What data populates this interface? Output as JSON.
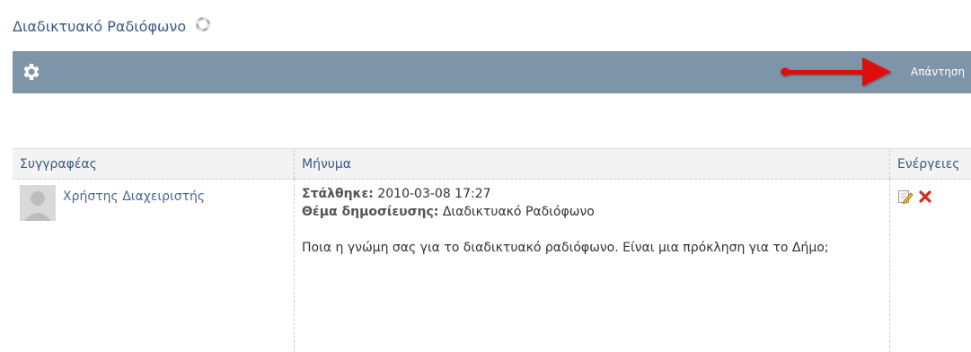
{
  "page": {
    "title": "Διαδικτυακό Ραδιόφωνο",
    "title_icon": "lifebuoy-icon"
  },
  "toolbar": {
    "settings_icon": "gear-icon",
    "reply_label": "Απάντηση",
    "annotation": "red-arrow-pointing-right",
    "color": "#7e94a8"
  },
  "table": {
    "headers": {
      "author": "Συγγραφέας",
      "message": "Μήνυμα",
      "actions": "Ενέργειες"
    },
    "rows": [
      {
        "author": "Χρήστης Διαχειριστής",
        "sent_label": "Στάλθηκε:",
        "sent_value": "2010-03-08 17:27",
        "subject_label": "Θέμα δημοσίευσης:",
        "subject_value": "Διαδικτυακό Ραδιόφωνο",
        "body": "Ποια η γνώμη σας για το διαδικτυακό ραδιόφωνο. Είναι μια πρόκληση για το Δήμο;",
        "actions": [
          "edit-icon",
          "delete-icon"
        ]
      }
    ]
  }
}
